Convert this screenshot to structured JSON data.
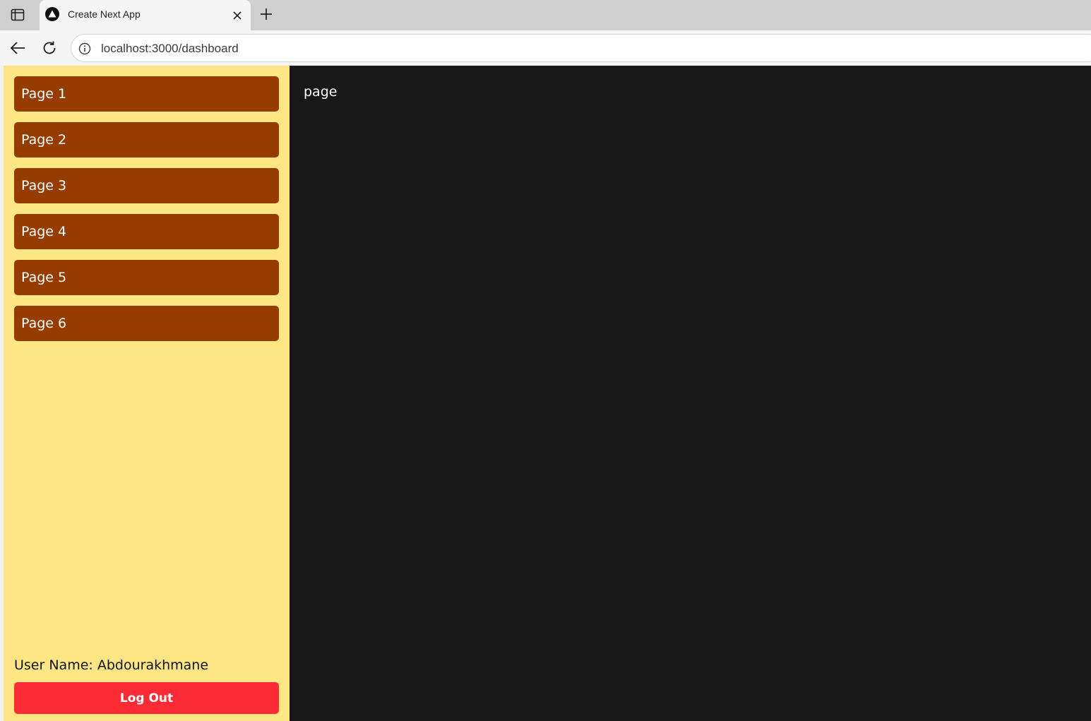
{
  "browser": {
    "tab": {
      "title": "Create Next App",
      "favicon": "nextjs-triangle-icon"
    },
    "url": "localhost:3000/dashboard"
  },
  "sidebar": {
    "items": [
      {
        "label": "Page 1"
      },
      {
        "label": "Page 2"
      },
      {
        "label": "Page 3"
      },
      {
        "label": "Page 4"
      },
      {
        "label": "Page 5"
      },
      {
        "label": "Page 6"
      }
    ],
    "user_name": "User Name: Abdourakhmane",
    "logout_label": "Log Out"
  },
  "main": {
    "text": "page"
  },
  "colors": {
    "sidebar_bg": "#fee685",
    "nav_item_bg": "#973c00",
    "logout_bg": "#fb2c36",
    "content_bg": "#181818"
  }
}
